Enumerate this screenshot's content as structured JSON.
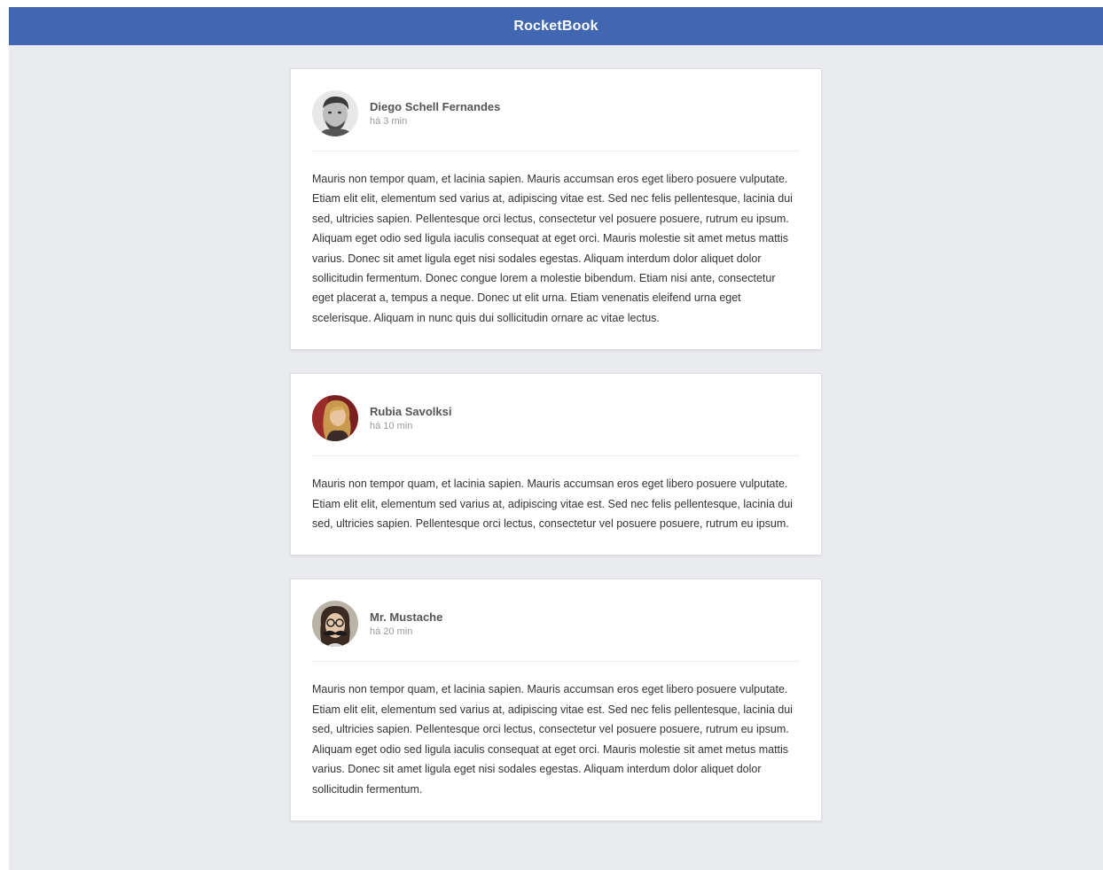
{
  "header": {
    "title": "RocketBook",
    "background": "#4267b2"
  },
  "posts": [
    {
      "author": "Diego Schell Fernandes",
      "time": "há 3 min",
      "avatar_icon": "man-with-beard-avatar",
      "content": "Mauris non tempor quam, et lacinia sapien. Mauris accumsan eros eget libero posuere vulputate. Etiam elit elit, elementum sed varius at, adipiscing vitae est. Sed nec felis pellentesque, lacinia dui sed, ultricies sapien. Pellentesque orci lectus, consectetur vel posuere posuere, rutrum eu ipsum. Aliquam eget odio sed ligula iaculis consequat at eget orci. Mauris molestie sit amet metus mattis varius. Donec sit amet ligula eget nisi sodales egestas. Aliquam interdum dolor aliquet dolor sollicitudin fermentum. Donec congue lorem a molestie bibendum. Etiam nisi ante, consectetur eget placerat a, tempus a neque. Donec ut elit urna. Etiam venenatis eleifend urna eget scelerisque. Aliquam in nunc quis dui sollicitudin ornare ac vitae lectus."
    },
    {
      "author": "Rubia Savolksi",
      "time": "há 10 min",
      "avatar_icon": "woman-with-blonde-hair-avatar",
      "content": "Mauris non tempor quam, et lacinia sapien. Mauris accumsan eros eget libero posuere vulputate. Etiam elit elit, elementum sed varius at, adipiscing vitae est. Sed nec felis pellentesque, lacinia dui sed, ultricies sapien. Pellentesque orci lectus, consectetur vel posuere posuere, rutrum eu ipsum."
    },
    {
      "author": "Mr. Mustache",
      "time": "há 20 min",
      "avatar_icon": "person-with-glasses-and-mustache-avatar",
      "content": "Mauris non tempor quam, et lacinia sapien. Mauris accumsan eros eget libero posuere vulputate. Etiam elit elit, elementum sed varius at, adipiscing vitae est. Sed nec felis pellentesque, lacinia dui sed, ultricies sapien. Pellentesque orci lectus, consectetur vel posuere posuere, rutrum eu ipsum. Aliquam eget odio sed ligula iaculis consequat at eget orci. Mauris molestie sit amet metus mattis varius. Donec sit amet ligula eget nisi sodales egestas. Aliquam interdum dolor aliquet dolor sollicitudin fermentum."
    }
  ]
}
